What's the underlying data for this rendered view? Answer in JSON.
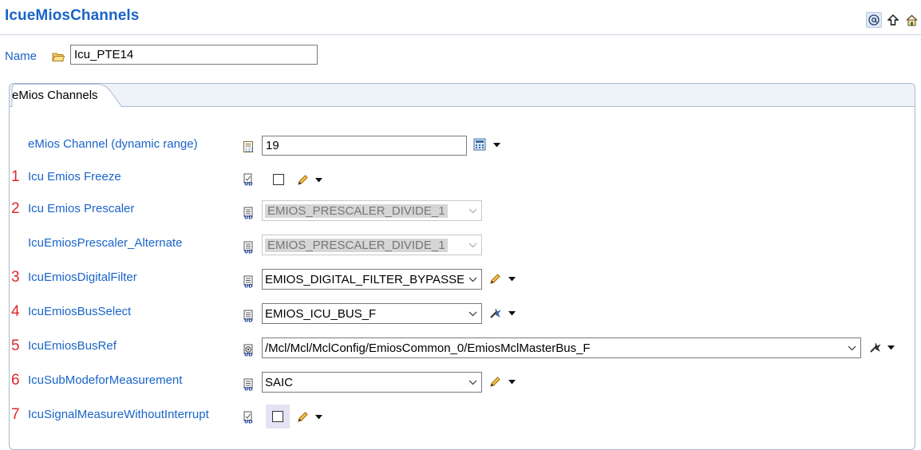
{
  "title": "IcueMiosChannels",
  "toolbar": {
    "items": [
      {
        "icon": "at-sign-icon",
        "glyph": "@"
      },
      {
        "icon": "up-arrow-icon",
        "glyph": "⇧"
      },
      {
        "icon": "home-icon",
        "glyph": "⌂"
      }
    ]
  },
  "name_field": {
    "label": "Name",
    "value": "Icu_PTE14"
  },
  "tab": {
    "label": "eMios Channels"
  },
  "rows": [
    {
      "number": "",
      "label": "eMios Channel (dynamic range)",
      "type": "number",
      "value": "19"
    },
    {
      "number": "1",
      "label": "Icu Emios Freeze",
      "type": "checkbox",
      "checked": false
    },
    {
      "number": "2",
      "label": "Icu Emios Prescaler",
      "type": "combo-disabled",
      "value": "EMIOS_PRESCALER_DIVIDE_1"
    },
    {
      "number": "",
      "label": "IcuEmiosPrescaler_Alternate",
      "type": "combo-disabled",
      "value": "EMIOS_PRESCALER_DIVIDE_1"
    },
    {
      "number": "3",
      "label": "IcuEmiosDigitalFilter",
      "type": "combo",
      "value": "EMIOS_DIGITAL_FILTER_BYPASSED"
    },
    {
      "number": "4",
      "label": "IcuEmiosBusSelect",
      "type": "combo",
      "value": "EMIOS_ICU_BUS_F"
    },
    {
      "number": "5",
      "label": "IcuEmiosBusRef",
      "type": "combo-wide",
      "value": "/Mcl/Mcl/MclConfig/EmiosCommon_0/EmiosMclMasterBus_F"
    },
    {
      "number": "6",
      "label": "IcuSubModeforMeasurement",
      "type": "combo",
      "value": "SAIC"
    },
    {
      "number": "7",
      "label": "IcuSignalMeasureWithoutInterrupt",
      "type": "checkbox",
      "checked": false
    }
  ],
  "colors": {
    "accent": "#1a64c8",
    "number_red": "#e0282a"
  }
}
